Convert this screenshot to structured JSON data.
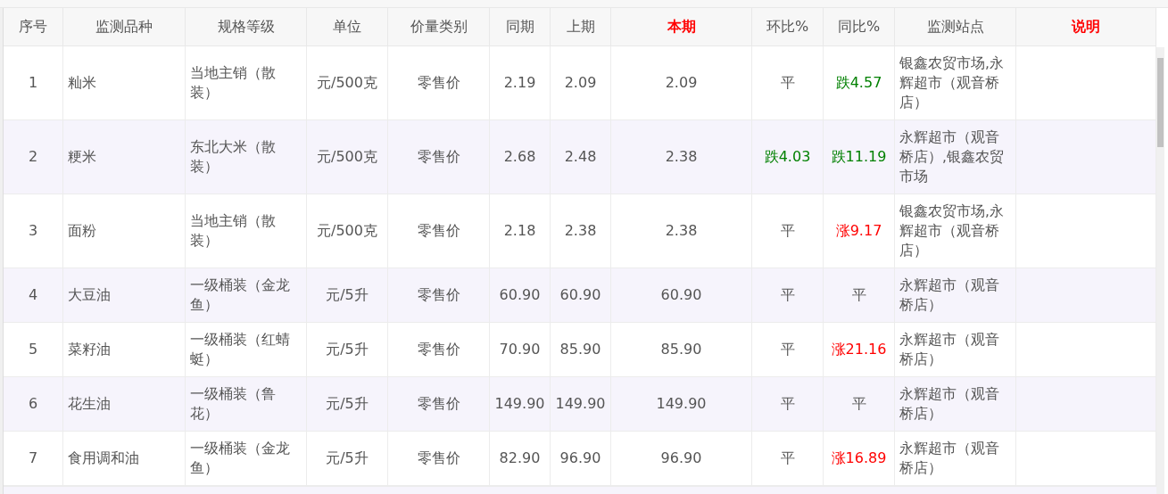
{
  "table": {
    "columns": [
      {
        "label": "序号",
        "highlight": false
      },
      {
        "label": "监测品种",
        "highlight": false
      },
      {
        "label": "规格等级",
        "highlight": false
      },
      {
        "label": "单位",
        "highlight": false
      },
      {
        "label": "价量类别",
        "highlight": false
      },
      {
        "label": "同期",
        "highlight": false
      },
      {
        "label": "上期",
        "highlight": false
      },
      {
        "label": "本期",
        "highlight": true
      },
      {
        "label": "环比%",
        "highlight": false
      },
      {
        "label": "同比%",
        "highlight": false
      },
      {
        "label": "监测站点",
        "highlight": false
      },
      {
        "label": "说明",
        "highlight": true
      }
    ],
    "rows": [
      {
        "no": "1",
        "item": "籼米",
        "grade": "当地主销（散装）",
        "unit": "元/500克",
        "price_type": "零售价",
        "same_period": "2.19",
        "last_period": "2.09",
        "current": "2.09",
        "mom": {
          "text": "平",
          "kind": "flat"
        },
        "yoy": {
          "text": "跌4.57",
          "kind": "down"
        },
        "stations": "银鑫农贸市场,永辉超市（观音桥店）"
      },
      {
        "no": "2",
        "item": "粳米",
        "grade": "东北大米（散装）",
        "unit": "元/500克",
        "price_type": "零售价",
        "same_period": "2.68",
        "last_period": "2.48",
        "current": "2.38",
        "mom": {
          "text": "跌4.03",
          "kind": "down"
        },
        "yoy": {
          "text": "跌11.19",
          "kind": "down"
        },
        "stations": "永辉超市（观音桥店）,银鑫农贸市场"
      },
      {
        "no": "3",
        "item": "面粉",
        "grade": "当地主销（散装）",
        "unit": "元/500克",
        "price_type": "零售价",
        "same_period": "2.18",
        "last_period": "2.38",
        "current": "2.38",
        "mom": {
          "text": "平",
          "kind": "flat"
        },
        "yoy": {
          "text": "涨9.17",
          "kind": "up"
        },
        "stations": "银鑫农贸市场,永辉超市（观音桥店）"
      },
      {
        "no": "4",
        "item": "大豆油",
        "grade": "一级桶装（金龙鱼）",
        "unit": "元/5升",
        "price_type": "零售价",
        "same_period": "60.90",
        "last_period": "60.90",
        "current": "60.90",
        "mom": {
          "text": "平",
          "kind": "flat"
        },
        "yoy": {
          "text": "平",
          "kind": "flat"
        },
        "stations": "永辉超市（观音桥店）"
      },
      {
        "no": "5",
        "item": "菜籽油",
        "grade": "一级桶装（红蜻蜓）",
        "unit": "元/5升",
        "price_type": "零售价",
        "same_period": "70.90",
        "last_period": "85.90",
        "current": "85.90",
        "mom": {
          "text": "平",
          "kind": "flat"
        },
        "yoy": {
          "text": "涨21.16",
          "kind": "up"
        },
        "stations": "永辉超市（观音桥店）"
      },
      {
        "no": "6",
        "item": "花生油",
        "grade": "一级桶装（鲁花）",
        "unit": "元/5升",
        "price_type": "零售价",
        "same_period": "149.90",
        "last_period": "149.90",
        "current": "149.90",
        "mom": {
          "text": "平",
          "kind": "flat"
        },
        "yoy": {
          "text": "平",
          "kind": "flat"
        },
        "stations": "永辉超市（观音桥店）"
      },
      {
        "no": "7",
        "item": "食用调和油",
        "grade": "一级桶装（金龙鱼）",
        "unit": "元/5升",
        "price_type": "零售价",
        "same_period": "82.90",
        "last_period": "96.90",
        "current": "96.90",
        "mom": {
          "text": "平",
          "kind": "flat"
        },
        "yoy": {
          "text": "涨16.89",
          "kind": "up"
        },
        "stations": "永辉超市（观音桥店）"
      }
    ]
  }
}
